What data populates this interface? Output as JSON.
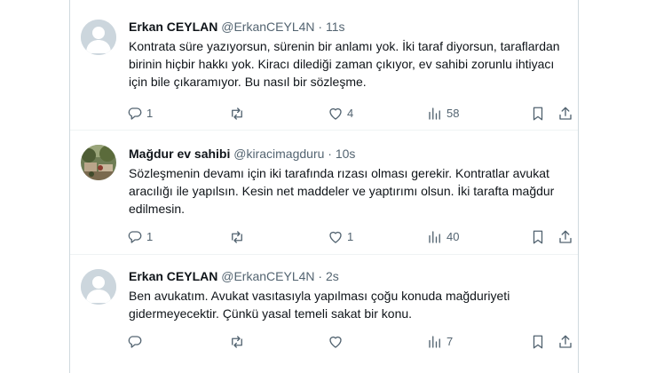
{
  "tweets": [
    {
      "name": "Erkan CEYLAN",
      "handle": "@ErkanCEYL4N",
      "separator": "·",
      "time": "11s",
      "text": "Kontrata süre yazıyorsun, sürenin bir anlamı yok. İki taraf diyorsun, taraflardan birinin hiçbir hakkı yok. Kiracı dilediği zaman çıkıyor, ev sahibi zorunlu ihtiyacı için bile çıkaramıyor. Bu nasıl bir sözleşme.",
      "replies": "1",
      "retweets": "",
      "likes": "4",
      "views": "58",
      "avatar": "default-avatar"
    },
    {
      "name": "Mağdur ev sahibi",
      "handle": "@kiracimagduru",
      "separator": "·",
      "time": "10s",
      "text": "Sözleşmenin devamı için iki tarafında rızası olması gerekir. Kontratlar avukat aracılığı ile yapılsın. Kesin net maddeler ve yaptırımı olsun. İki tarafta mağdur edilmesin.",
      "replies": "1",
      "retweets": "",
      "likes": "1",
      "views": "40",
      "avatar": "photo-avatar"
    },
    {
      "name": "Erkan CEYLAN",
      "handle": "@ErkanCEYL4N",
      "separator": "·",
      "time": "2s",
      "text": "Ben avukatım. Avukat vasıtasıyla yapılması çoğu konuda mağduriyeti gidermeyecektir. Çünkü yasal temeli sakat bir konu.",
      "replies": "",
      "retweets": "",
      "likes": "",
      "views": "7",
      "avatar": "default-avatar"
    }
  ],
  "colors": {
    "text": "#0f1419",
    "secondary": "#536471",
    "border": "#cfd9de",
    "avatar_bg": "#ccd6dd"
  },
  "icons": [
    "reply-icon",
    "retweet-icon",
    "like-icon",
    "views-icon",
    "bookmark-icon",
    "share-icon"
  ]
}
